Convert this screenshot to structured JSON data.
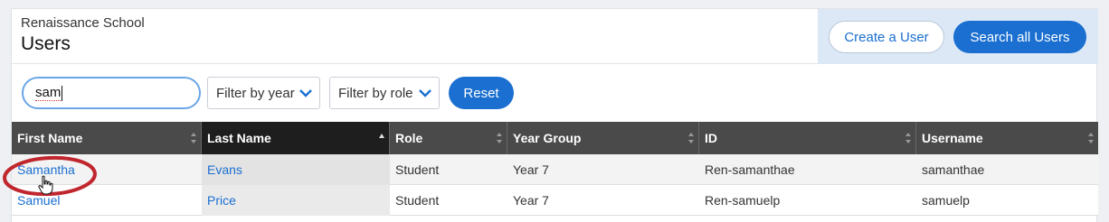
{
  "header": {
    "school": "Renaissance School",
    "title": "Users",
    "create_button": "Create a User",
    "search_all_button": "Search all Users"
  },
  "filters": {
    "search_value": "sam",
    "year_select": "Filter by year",
    "role_select": "Filter by role",
    "reset_button": "Reset"
  },
  "table": {
    "columns": [
      "First Name",
      "Last Name",
      "Role",
      "Year Group",
      "ID",
      "Username"
    ],
    "rows": [
      [
        "Samantha",
        "Evans",
        "Student",
        "Year 7",
        "Ren-samanthae",
        "samanthae"
      ],
      [
        "Samuel",
        "Price",
        "Student",
        "Year 7",
        "Ren-samuelp",
        "samuelp"
      ]
    ]
  },
  "colors": {
    "primary": "#1a6fd0",
    "header_bg": "#4a4a4a",
    "annotation": "#c0262d"
  }
}
